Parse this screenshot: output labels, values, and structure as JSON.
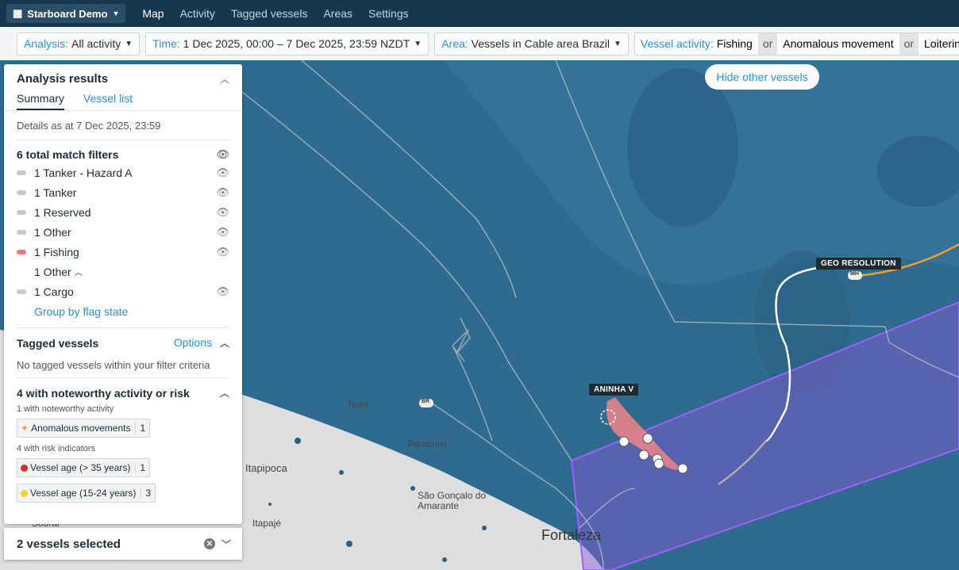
{
  "nav": {
    "brand": "Starboard Demo",
    "items": [
      "Map",
      "Activity",
      "Tagged vessels",
      "Areas",
      "Settings"
    ]
  },
  "filters": {
    "analysis_label": "Analysis:",
    "analysis_value": "All activity",
    "time_label": "Time:",
    "time_value": "1 Dec 2025, 00:00 – 7 Dec 2025, 23:59 NZDT",
    "area_label": "Area:",
    "area_value": "Vessels in Cable area Brazil",
    "activity_label": "Vessel activity:",
    "activity_values": [
      "Fishing",
      "Anomalous movement",
      "Loitering"
    ],
    "or": "or"
  },
  "map": {
    "hide_button": "Hide other vessels",
    "vessel_labels": [
      "ANINHA V",
      "GEO RESOLUTION"
    ],
    "track_badges": [
      "BR",
      "MH"
    ],
    "places": [
      "Trairi",
      "Paracuru",
      "Itapipoca",
      "São Gonçalo do Amarante",
      "Itapajé",
      "Sobral",
      "Fortaleza"
    ],
    "colors": {
      "sea": "#2d6a8e",
      "land": "#dcdcdc",
      "area": "#8a5ad6",
      "fishing": "#e8828a",
      "track": "#ffffff",
      "other_track": "#f0a030"
    }
  },
  "panel": {
    "title": "Analysis results",
    "tabs": [
      "Summary",
      "Vessel list"
    ],
    "details": "Details as at 7 Dec 2025, 23:59",
    "total": "6 total match filters",
    "rows": [
      {
        "label": "1 Tanker - Hazard A",
        "color": "#c5c8cb"
      },
      {
        "label": "1 Tanker",
        "color": "#c5c8cb"
      },
      {
        "label": "1 Reserved",
        "color": "#c5c8cb"
      },
      {
        "label": "1 Other",
        "color": "#c5c8cb"
      },
      {
        "label": "1 Fishing",
        "color": "#f07a7a"
      },
      {
        "label": "1 Other",
        "color": ""
      },
      {
        "label": "1 Cargo",
        "color": "#c5c8cb"
      }
    ],
    "group_link": "Group by flag state",
    "tagged_title": "Tagged vessels",
    "tagged_options": "Options",
    "tagged_empty": "No tagged vessels within your filter criteria",
    "noteworthy_title": "4 with noteworthy activity or risk",
    "noteworthy_sub": "1 with noteworthy activity",
    "anomalous_label": "Anomalous movements",
    "anomalous_count": "1",
    "risk_sub": "4 with risk indicators",
    "risk_badges": [
      {
        "label": "Vessel age (> 35 years)",
        "count": "1",
        "color": "#d42c2c"
      },
      {
        "label": "Vessel age (15-24 years)",
        "count": "3",
        "color": "#f5d02e"
      }
    ],
    "selected": "2 vessels selected"
  }
}
